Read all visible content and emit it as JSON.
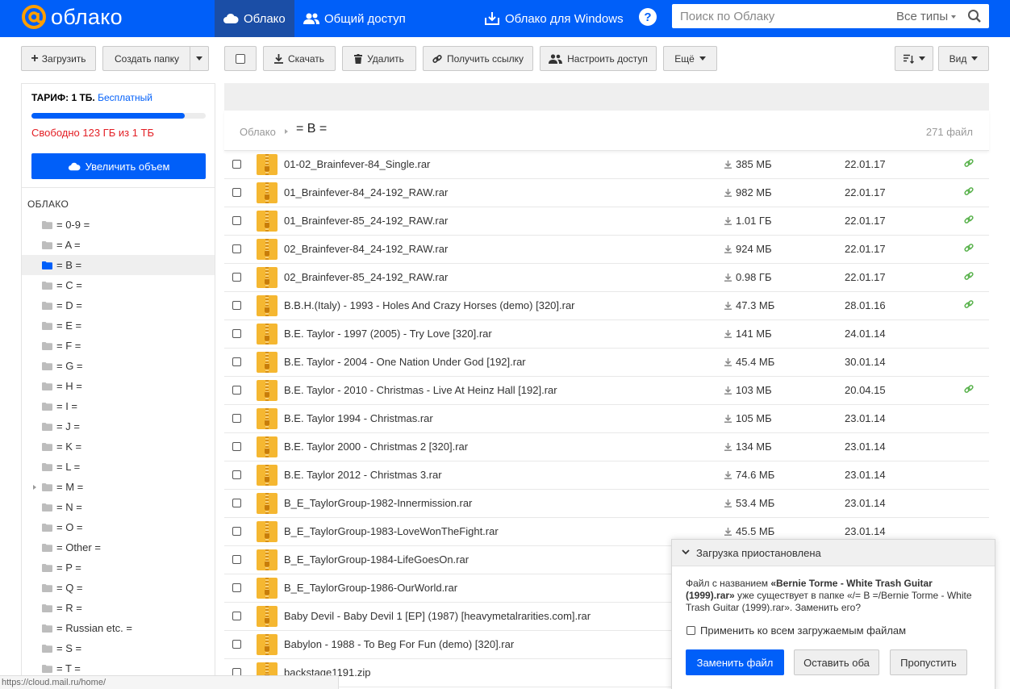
{
  "header": {
    "logo_text": "облако",
    "nav": [
      {
        "label": "Облако",
        "active": true
      },
      {
        "label": "Общий доступ",
        "active": false
      },
      {
        "label": "Облако для Windows",
        "active": false
      }
    ],
    "help_label": "?",
    "search": {
      "placeholder": "Поиск по Облаку",
      "types_label": "Все типы"
    }
  },
  "toolbar": {
    "upload": "Загрузить",
    "create_folder": "Создать папку",
    "download": "Скачать",
    "delete": "Удалить",
    "get_link": "Получить ссылку",
    "share_access": "Настроить доступ",
    "more": "Ещё",
    "view": "Вид"
  },
  "sidebar": {
    "tariff_label": "ТАРИФ: 1 ТБ.",
    "tariff_plan": "Бесплатный",
    "quota_used_fraction": 0.88,
    "quota_text": "Свободно 123 ГБ из 1 ТБ",
    "increase_button": "Увеличить объем",
    "section_title": "ОБЛАКО",
    "folders": [
      {
        "label": "= 0-9 =",
        "active": false,
        "expandable": false
      },
      {
        "label": "= A =",
        "active": false,
        "expandable": false
      },
      {
        "label": "= B =",
        "active": true,
        "expandable": false
      },
      {
        "label": "= C =",
        "active": false,
        "expandable": false
      },
      {
        "label": "= D =",
        "active": false,
        "expandable": false
      },
      {
        "label": "= E =",
        "active": false,
        "expandable": false
      },
      {
        "label": "= F =",
        "active": false,
        "expandable": false
      },
      {
        "label": "= G =",
        "active": false,
        "expandable": false
      },
      {
        "label": "= H =",
        "active": false,
        "expandable": false
      },
      {
        "label": "= I =",
        "active": false,
        "expandable": false
      },
      {
        "label": "= J =",
        "active": false,
        "expandable": false
      },
      {
        "label": "= K =",
        "active": false,
        "expandable": false
      },
      {
        "label": "= L =",
        "active": false,
        "expandable": false
      },
      {
        "label": "= M =",
        "active": false,
        "expandable": true
      },
      {
        "label": "= N =",
        "active": false,
        "expandable": false
      },
      {
        "label": "= O =",
        "active": false,
        "expandable": false
      },
      {
        "label": "= Other =",
        "active": false,
        "expandable": false
      },
      {
        "label": "= P =",
        "active": false,
        "expandable": false
      },
      {
        "label": "= Q =",
        "active": false,
        "expandable": false
      },
      {
        "label": "= R =",
        "active": false,
        "expandable": false
      },
      {
        "label": "= Russian etc. =",
        "active": false,
        "expandable": false
      },
      {
        "label": "= S =",
        "active": false,
        "expandable": false
      },
      {
        "label": "= T =",
        "active": false,
        "expandable": false
      }
    ]
  },
  "main": {
    "breadcrumb_root": "Облако",
    "breadcrumb_current": "= B =",
    "file_count": "271 файл",
    "files": [
      {
        "name": "01-02_Brainfever-84_Single.rar",
        "size": "385 МБ",
        "date": "22.01.17",
        "shared": true
      },
      {
        "name": "01_Brainfever-84_24-192_RAW.rar",
        "size": "982 МБ",
        "date": "22.01.17",
        "shared": true
      },
      {
        "name": "01_Brainfever-85_24-192_RAW.rar",
        "size": "1.01 ГБ",
        "date": "22.01.17",
        "shared": true
      },
      {
        "name": "02_Brainfever-84_24-192_RAW.rar",
        "size": "924 МБ",
        "date": "22.01.17",
        "shared": true
      },
      {
        "name": "02_Brainfever-85_24-192_RAW.rar",
        "size": "0.98 ГБ",
        "date": "22.01.17",
        "shared": true
      },
      {
        "name": "B.B.H.(Italy) - 1993 - Holes And Crazy Horses (demo) [320].rar",
        "size": "47.3 МБ",
        "date": "28.01.16",
        "shared": true
      },
      {
        "name": "B.E. Taylor - 1997 (2005) - Try Love [320].rar",
        "size": "141 МБ",
        "date": "24.01.14",
        "shared": false
      },
      {
        "name": "B.E. Taylor - 2004 - One Nation Under God [192].rar",
        "size": "45.4 МБ",
        "date": "30.01.14",
        "shared": false
      },
      {
        "name": "B.E. Taylor - 2010 - Christmas - Live At Heinz Hall [192].rar",
        "size": "103 МБ",
        "date": "20.04.15",
        "shared": true
      },
      {
        "name": "B.E. Taylor 1994 - Christmas.rar",
        "size": "105 МБ",
        "date": "23.01.14",
        "shared": false
      },
      {
        "name": "B.E. Taylor 2000 - Christmas 2 [320].rar",
        "size": "134 МБ",
        "date": "23.01.14",
        "shared": false
      },
      {
        "name": "B.E. Taylor 2012 - Christmas 3.rar",
        "size": "74.6 МБ",
        "date": "23.01.14",
        "shared": false
      },
      {
        "name": "B_E_TaylorGroup-1982-Innermission.rar",
        "size": "53.4 МБ",
        "date": "23.01.14",
        "shared": false
      },
      {
        "name": "B_E_TaylorGroup-1983-LoveWonTheFight.rar",
        "size": "45.5 МБ",
        "date": "23.01.14",
        "shared": false
      },
      {
        "name": "B_E_TaylorGroup-1984-LifeGoesOn.rar",
        "size": "",
        "date": "",
        "shared": false
      },
      {
        "name": "B_E_TaylorGroup-1986-OurWorld.rar",
        "size": "",
        "date": "",
        "shared": false
      },
      {
        "name": "Baby Devil - Baby Devil 1 [EP] (1987) [heavymetalrarities.com].rar",
        "size": "",
        "date": "",
        "shared": false
      },
      {
        "name": "Babylon - 1988 - To Beg For Fun (demo) [320].rar",
        "size": "",
        "date": "",
        "shared": false
      },
      {
        "name": "backstage1191.zip",
        "size": "",
        "date": "",
        "shared": false
      }
    ]
  },
  "dialog": {
    "title": "Загрузка приостановлена",
    "msg_prefix": "Файл с названием ",
    "msg_file": "«Bernie Torme - White Trash Guitar (1999).rar»",
    "msg_suffix": " уже существует в папке «/= B =/Bernie Torme - White Trash Guitar (1999).rar». Заменить его?",
    "apply_all": "Применить ко всем загружаемым файлам",
    "replace": "Заменить файл",
    "keep_both": "Оставить оба",
    "skip": "Пропустить"
  },
  "status_url": "https://cloud.mail.ru/home/",
  "colors": {
    "accent": "#005ff9",
    "nav_active": "#1b4ea6",
    "warning": "#e31e24",
    "link_icon": "#57b14a",
    "archive_icon": "#f5b731"
  }
}
